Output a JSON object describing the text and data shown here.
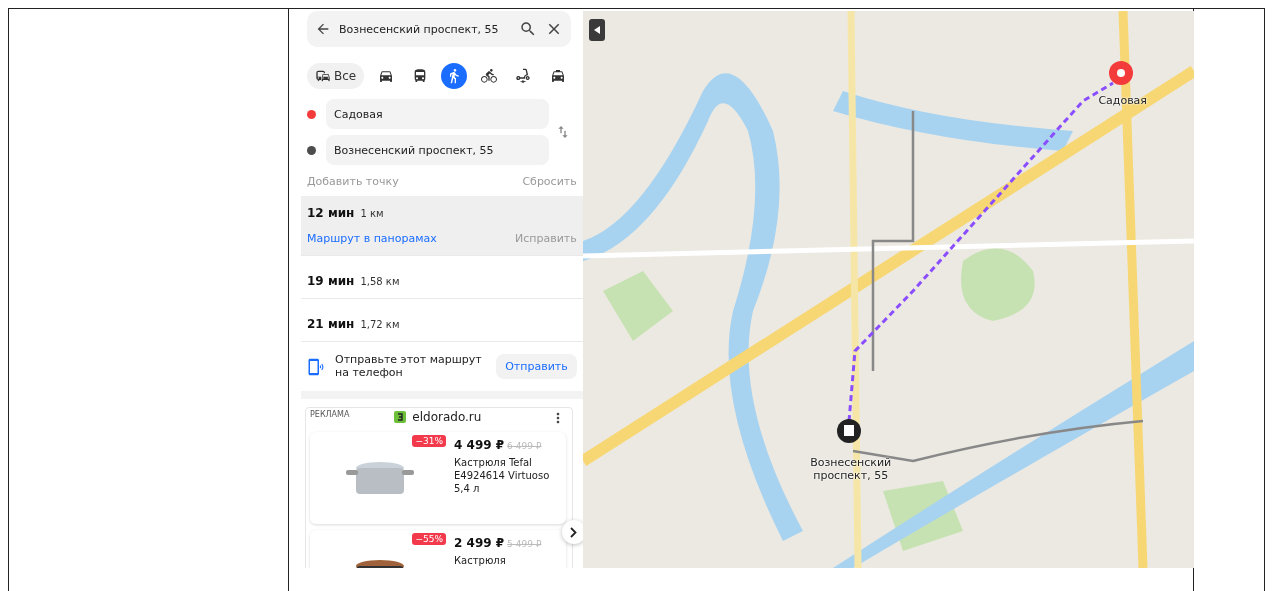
{
  "search": {
    "value": "Вознесенский проспект, 55"
  },
  "modes": [
    {
      "kind": "all",
      "label": "Все",
      "selected": false
    },
    {
      "kind": "car",
      "selected": false
    },
    {
      "kind": "bus",
      "selected": false
    },
    {
      "kind": "walk",
      "selected": true
    },
    {
      "kind": "bike",
      "selected": false
    },
    {
      "kind": "scooter",
      "selected": false
    },
    {
      "kind": "taxi",
      "selected": false
    }
  ],
  "points": [
    {
      "value": "Садовая",
      "color": "#f43b3b"
    },
    {
      "value": "Вознесенский проспект, 55",
      "color": "#4d4d4d"
    }
  ],
  "add_point": "Добавить точку",
  "reset": "Сбросить",
  "routes": [
    {
      "time": "12 мин",
      "distance": "1 км",
      "selected": true,
      "panorama_link": "Маршрут в панорамах",
      "fix_link": "Исправить"
    },
    {
      "time": "19 мин",
      "distance": "1,58 км",
      "selected": false
    },
    {
      "time": "21 мин",
      "distance": "1,72 км",
      "selected": false
    }
  ],
  "send": {
    "text": "Отправьте этот маршрут на телефон",
    "button": "Отправить"
  },
  "ad": {
    "label": "РЕКЛАМА",
    "domain": "eldorado.ru",
    "products": [
      {
        "discount": "−31%",
        "price": "4 499 ₽",
        "old_price": "6 499 ₽",
        "name": "Кастрюля Tefal E4924614 Virtuoso 5,4 л"
      },
      {
        "discount": "−55%",
        "price": "2 499 ₽",
        "old_price": "5 499 ₽",
        "name": "Кастрюля"
      }
    ]
  },
  "map": {
    "start_label": "Садовая",
    "end_label": "Вознесенский проспект, 55"
  }
}
